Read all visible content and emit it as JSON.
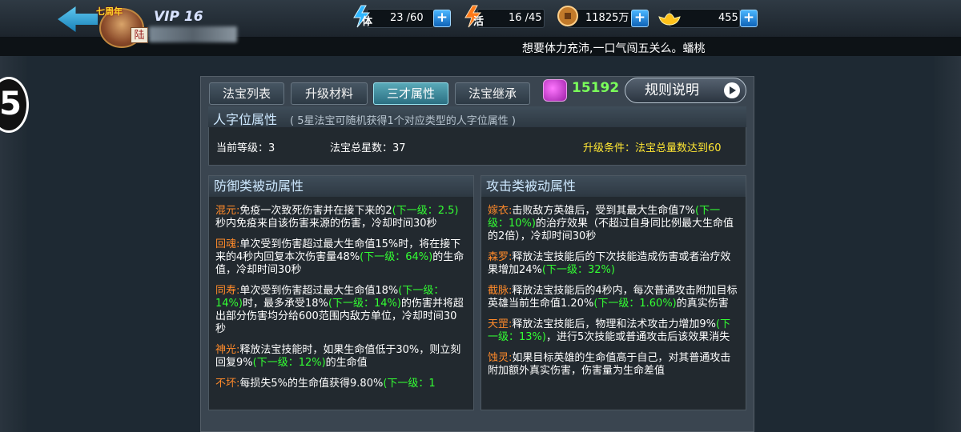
{
  "header": {
    "vip": "VIP 16",
    "avatar_badge": "七周年",
    "avatar_tag": "陆",
    "stamina_label": "体",
    "stamina": "23 /60",
    "energy_label": "活",
    "energy": "16 /45",
    "coins": "11825万",
    "gold": "455",
    "plus": "+",
    "marquee": "想要体力充沛,一口气闯五关么。蟠桃"
  },
  "step_number": "5",
  "tabs": [
    "法宝列表",
    "升级材料",
    "三才属性",
    "法宝继承"
  ],
  "active_tab": 2,
  "gems": "15192",
  "rules_button": "规则说明",
  "info": {
    "title": "人字位属性",
    "desc": "( 5星法宝可随机获得1个对应类型的人字位属性 )",
    "level": "当前等级：3",
    "stars": "法宝总星数：37",
    "upgrade": "升级条件：法宝总量数达到60"
  },
  "defense": {
    "title": "防御类被动属性",
    "entries": [
      {
        "name": "混元:",
        "p1": "免疫一次致死伤害并在接下来的2",
        "n1": "(下一级：2.5)",
        "p2": "秒内免疫来自该伤害来源的伤害，冷却时间30秒",
        "n2": "",
        "p3": ""
      },
      {
        "name": "回魂:",
        "p1": "单次受到伤害超过最大生命值15%时，将在接下来的4秒内回复本次伤害量48%",
        "n1": "(下一级：64%)",
        "p2": "的生命值，冷却时间30秒",
        "n2": "",
        "p3": ""
      },
      {
        "name": "同寿:",
        "p1": "单次受到伤害超过最大生命值18%",
        "n1": "(下一级：14%)",
        "p2": "时，最多承受18%",
        "n2": "(下一级：14%)",
        "p3": "的伤害并将超出部分伤害均分给600范围内敌方单位，冷却时间30秒"
      },
      {
        "name": "神光:",
        "p1": "释放法宝技能时，如果生命值低于30%，则立刻回复9%",
        "n1": "(下一级：12%)",
        "p2": "的生命值",
        "n2": "",
        "p3": ""
      },
      {
        "name": "不坏:",
        "p1": "每损失5%的生命值获得9.80%",
        "n1": "(下一级：1",
        "p2": "",
        "n2": "",
        "p3": ""
      }
    ]
  },
  "attack": {
    "title": "攻击类被动属性",
    "entries": [
      {
        "name": "嫁衣:",
        "p1": "击败敌方英雄后，受到其最大生命值7%",
        "n1": "(下一级：10%)",
        "p2": "的治疗效果（不超过自身同比例最大生命值的2倍），冷却时间30秒",
        "n2": "",
        "p3": ""
      },
      {
        "name": "森罗:",
        "p1": "释放法宝技能后的下次技能造成伤害或者治疗效果增加24%",
        "n1": "(下一级：32%)",
        "p2": "",
        "n2": "",
        "p3": ""
      },
      {
        "name": "截脉:",
        "p1": "释放法宝技能后的4秒内，每次普通攻击附加目标英雄当前生命值1.20%",
        "n1": "(下一级：1.60%)",
        "p2": "的真实伤害",
        "n2": "",
        "p3": ""
      },
      {
        "name": "天罡:",
        "p1": "释放法宝技能后，物理和法术攻击力增加9%",
        "n1": "(下一级：13%)",
        "p2": "，进行5次技能或普通攻击后该效果消失",
        "n2": "",
        "p3": ""
      },
      {
        "name": "蚀灵:",
        "p1": "如果目标英雄的生命值高于自己，对其普通攻击附加额外真实伤害，伤害量为生命差值",
        "n1": "",
        "p2": "",
        "n2": "",
        "p3": ""
      }
    ]
  }
}
